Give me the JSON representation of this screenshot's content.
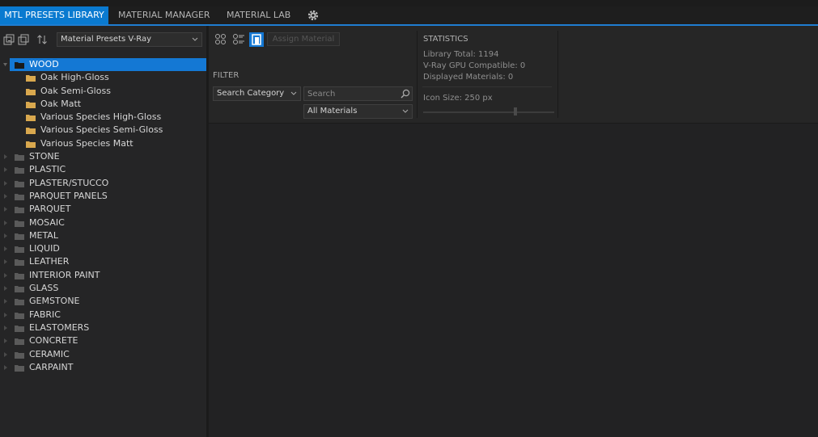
{
  "tabs": {
    "library": "MTL PRESETS LIBRARY",
    "manager": "MATERIAL MANAGER",
    "lab": "MATERIAL LAB"
  },
  "left": {
    "preset_select": "Material Presets V-Ray"
  },
  "tree": {
    "selected": {
      "label": "WOOD"
    },
    "children": [
      "Oak High-Gloss",
      "Oak Semi-Gloss",
      "Oak Matt",
      "Various Species High-Gloss",
      "Various Species Semi-Gloss",
      "Various Species Matt"
    ],
    "categories": [
      "STONE",
      "PLASTIC",
      "PLASTER/STUCCO",
      "PARQUET PANELS",
      "PARQUET",
      "MOSAIC",
      "METAL",
      "LIQUID",
      "LEATHER",
      "INTERIOR PAINT",
      "GLASS",
      "GEMSTONE",
      "FABRIC",
      "ELASTOMERS",
      "CONCRETE",
      "CERAMIC",
      "CARPAINT"
    ]
  },
  "toolbar": {
    "assign_label": "Assign Material"
  },
  "filter": {
    "label": "FILTER",
    "category_select": "Search Category",
    "search_placeholder": "Search",
    "materials_select": "All Materials"
  },
  "stats": {
    "title": "STATISTICS",
    "library_total": "Library Total: 1194",
    "gpu_compatible": "V-Ray GPU Compatible: 0",
    "displayed": "Displayed Materials: 0",
    "icon_size": "Icon Size: 250 px"
  },
  "colors": {
    "accent": "#1478d4",
    "folder": "#d9a84e",
    "folder_dark": "#5a5a5a"
  }
}
